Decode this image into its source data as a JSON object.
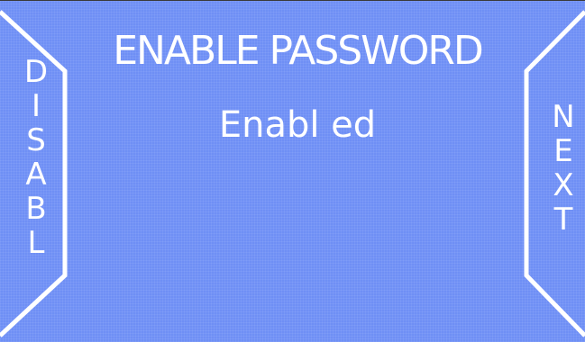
{
  "colors": {
    "panel_background": "#6f8ff5",
    "text": "#ffffff",
    "outline": "#ffffff"
  },
  "header": {
    "title": "ENABLE PASSWORD"
  },
  "main": {
    "status_value": "Enabl ed"
  },
  "left_button": {
    "label": "DISABL",
    "letters": [
      "D",
      "I",
      "S",
      "A",
      "B",
      "L"
    ]
  },
  "right_button": {
    "label": "NEXT",
    "letters": [
      "N",
      "E",
      "X",
      "T"
    ]
  }
}
